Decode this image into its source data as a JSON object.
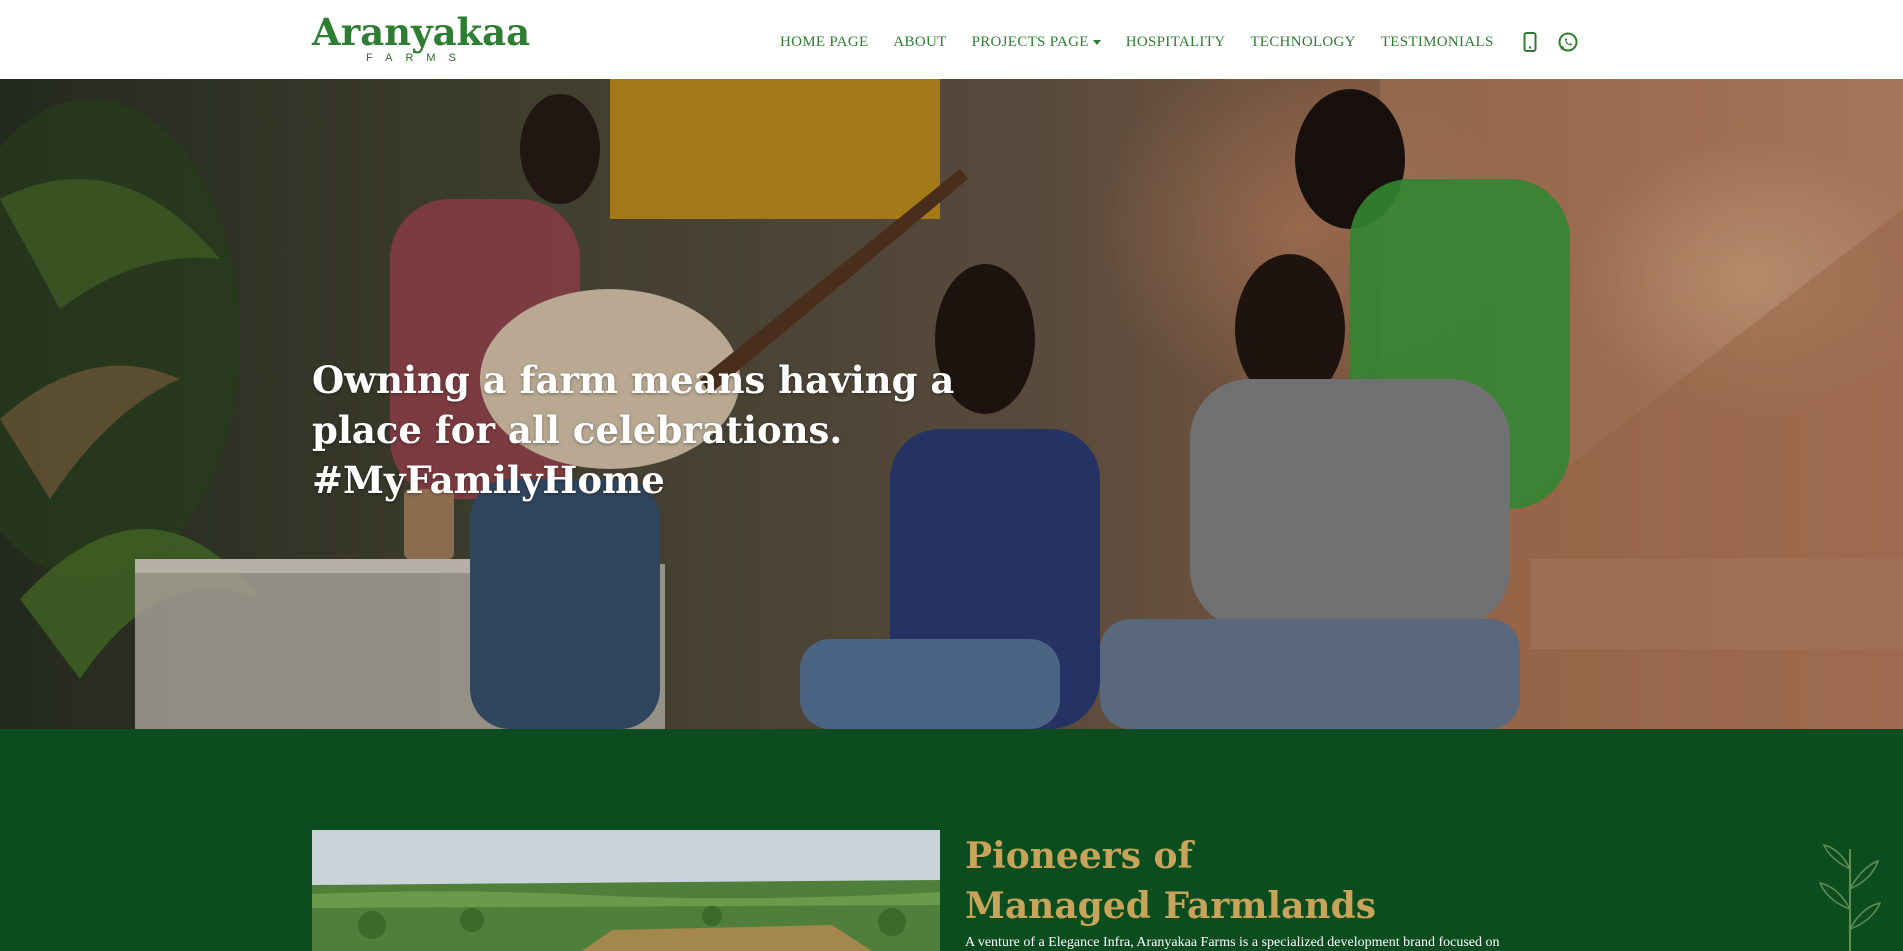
{
  "brand": {
    "name": "Aranyakaa",
    "sub": "FARMS"
  },
  "nav": {
    "items": [
      {
        "label": "HOME PAGE"
      },
      {
        "label": "ABOUT"
      },
      {
        "label": "PROJECTS PAGE"
      },
      {
        "label": "HOSPITALITY"
      },
      {
        "label": "TECHNOLOGY"
      },
      {
        "label": "TESTIMONIALS"
      }
    ],
    "icons": [
      "phone-icon",
      "whatsapp-icon"
    ]
  },
  "hero": {
    "headline": "Owning a farm means having a place for all celebrations. #MyFamilyHome"
  },
  "about": {
    "title_line1": "Pioneers of",
    "title_line2": "Managed Farmlands",
    "intro": "A venture of a Elegance Infra, Aranyakaa Farms is a specialized development brand focused on"
  },
  "colors": {
    "brand_green": "#2e7d32",
    "section_green": "#0b4d1f",
    "gold": "#c8a45a"
  }
}
